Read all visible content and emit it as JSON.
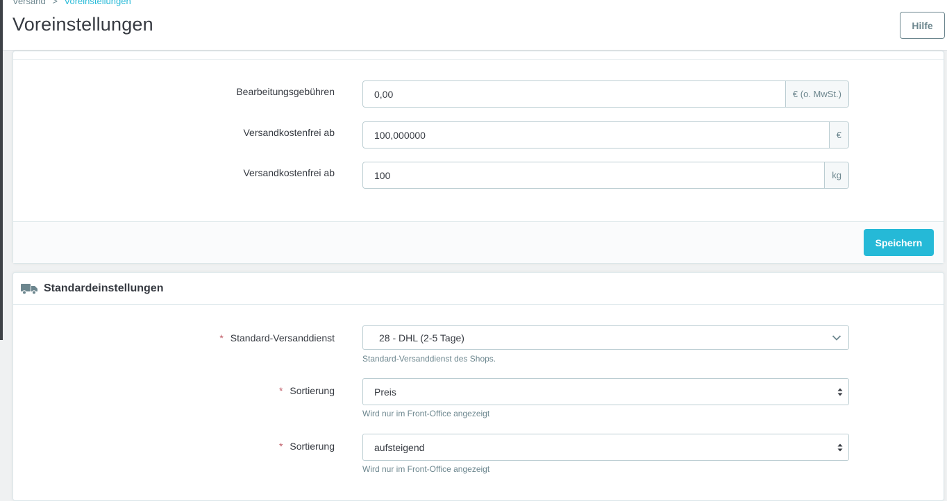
{
  "breadcrumb": {
    "parent": "Versand",
    "separator": ">",
    "current": "Voreinstellungen"
  },
  "header": {
    "title": "Voreinstellungen",
    "help_label": "Hilfe"
  },
  "fees_panel": {
    "rows": [
      {
        "label": "Bearbeitungsgebühren",
        "value": "0,00",
        "unit": "€ (o. MwSt.)"
      },
      {
        "label": "Versandkostenfrei ab",
        "value": "100,000000",
        "unit": "€"
      },
      {
        "label": "Versandkostenfrei ab",
        "value": "100",
        "unit": "kg"
      }
    ],
    "save_label": "Speichern"
  },
  "defaults_panel": {
    "title": "Standardeinstellungen",
    "required_mark": "*",
    "carrier": {
      "label": "Standard-Versanddienst",
      "value": "28 - DHL (2-5 Tage)",
      "help": "Standard-Versanddienst des Shops."
    },
    "sort_by": {
      "label": "Sortierung",
      "value": "Preis",
      "help": "Wird nur im Front-Office angezeigt"
    },
    "sort_order": {
      "label": "Sortierung",
      "value": "aufsteigend",
      "help": "Wird nur im Front-Office angezeigt"
    }
  },
  "colors": {
    "accent": "#25b9d7",
    "required": "#c05c67",
    "text": "#363a41",
    "muted": "#6c868e"
  }
}
